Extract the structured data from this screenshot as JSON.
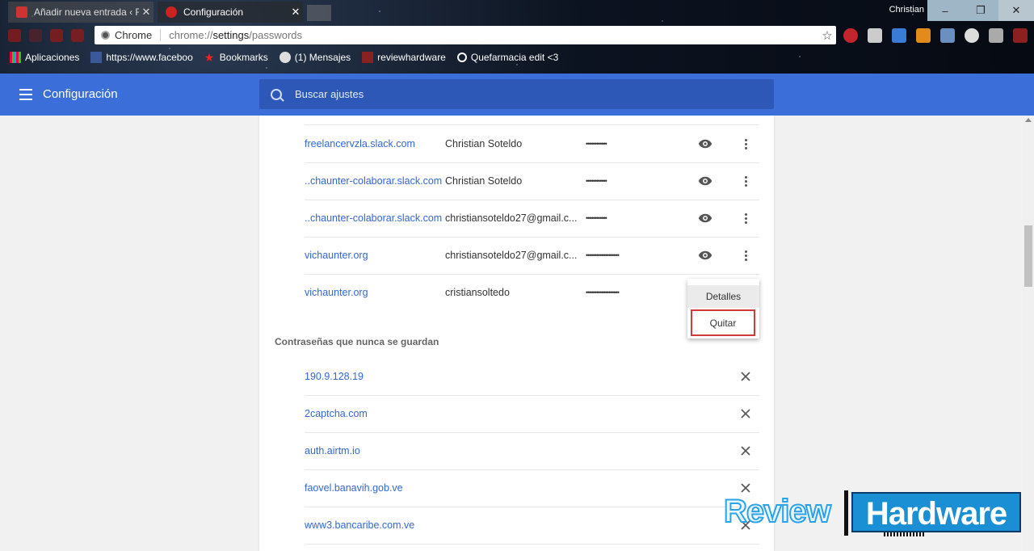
{
  "window": {
    "tabs": [
      {
        "title": "Añadir nueva entrada ‹ R..."
      },
      {
        "title": "Configuración"
      }
    ],
    "user": "Christian",
    "controls": {
      "minimize": "–",
      "maximize": "❐",
      "close": "✕"
    }
  },
  "omnibox": {
    "chip": "Chrome",
    "url_prefix": "chrome://",
    "url_bold": "settings",
    "url_suffix": "/passwords"
  },
  "bookmarks": [
    {
      "label": "Aplicaciones",
      "icon": "apps-grid-icon"
    },
    {
      "label": "https://www.faceboo",
      "icon": "facebook-icon"
    },
    {
      "label": "Bookmarks",
      "icon": "star-icon"
    },
    {
      "label": "(1) Mensajes",
      "icon": "messages-icon"
    },
    {
      "label": "reviewhardware",
      "icon": "bookmark-icon"
    },
    {
      "label": "Quefarmacia edit <3",
      "icon": "search-icon"
    }
  ],
  "app": {
    "title": "Configuración",
    "search_placeholder": "Buscar ajustes"
  },
  "saved_passwords": [
    {
      "site": "freelancervzla.slack.com",
      "user": "Christian Soteldo",
      "password": "••••••••••••"
    },
    {
      "site": "..chaunter-colaborar.slack.com",
      "user": "Christian Soteldo",
      "password": "••••••••••••"
    },
    {
      "site": "..chaunter-colaborar.slack.com",
      "user": "christiansoteldo27@gmail.c...",
      "password": "••••••••••••"
    },
    {
      "site": "vichaunter.org",
      "user": "christiansoteldo27@gmail.c...",
      "password": "•••••••••••••••••••"
    },
    {
      "site": "vichaunter.org",
      "user": "cristiansoltedo",
      "password": "•••••••••••••••••••"
    }
  ],
  "context_menu": {
    "details": "Detalles",
    "remove": "Quitar"
  },
  "never_saved": {
    "title": "Contraseñas que nunca se guardan",
    "items": [
      "190.9.128.19",
      "2captcha.com",
      "auth.airtm.io",
      "faovel.banavih.gob.ve",
      "www3.bancaribe.com.ve"
    ]
  },
  "watermark": {
    "part1": "Review",
    "part2": "Hardware"
  },
  "colors": {
    "accent": "#3b6ed8",
    "link": "#3367d6",
    "highlight_border": "#d23b3b"
  }
}
